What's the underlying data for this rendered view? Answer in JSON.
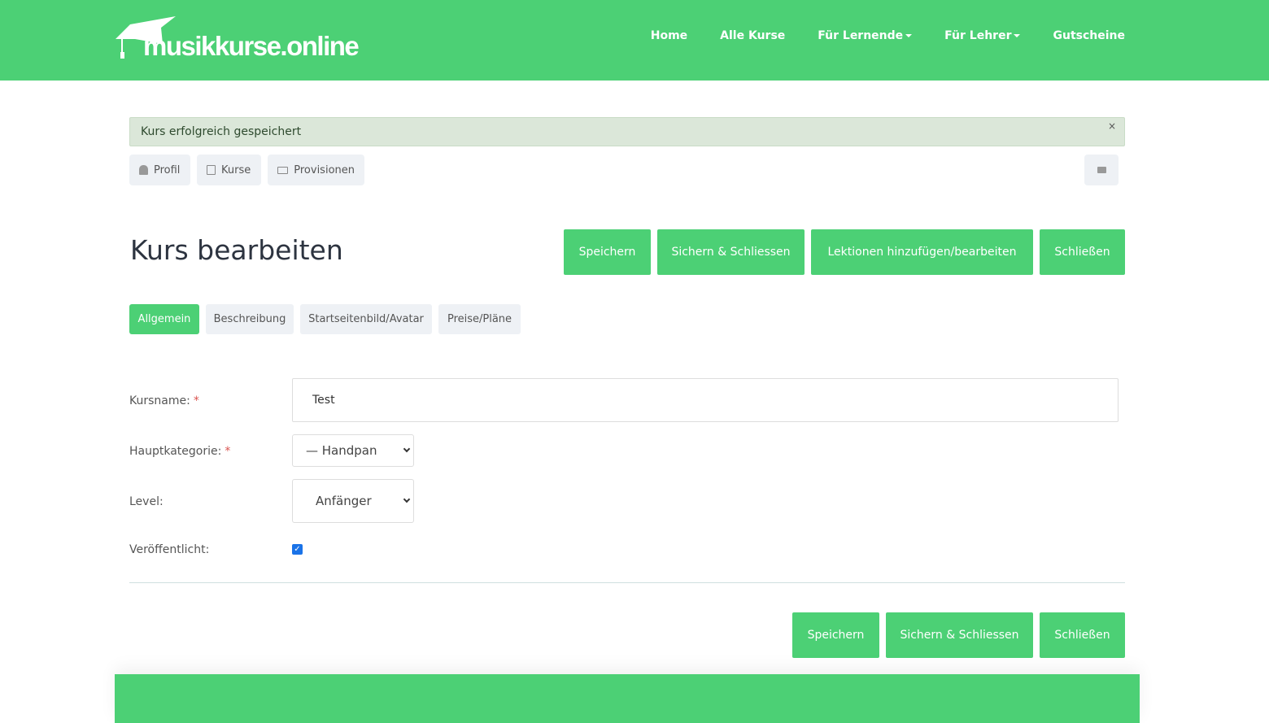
{
  "header": {
    "logo": "musikkurse.online",
    "nav": [
      "Home",
      "Alle Kurse",
      "Für Lernende",
      "Für Lehrer",
      "Gutscheine"
    ]
  },
  "alert": {
    "message": "Kurs erfolgreich gespeichert",
    "close": "×"
  },
  "profile_nav": {
    "profil": "Profil",
    "kurse": "Kurse",
    "provisionen": "Provisionen"
  },
  "page": {
    "title": "Kurs bearbeiten"
  },
  "actions": {
    "save": "Speichern",
    "save_close": "Sichern & Schliessen",
    "lessons": "Lektionen hinzufügen/bearbeiten",
    "close": "Schließen"
  },
  "tabs": [
    "Allgemein",
    "Beschreibung",
    "Startseitenbild/Avatar",
    "Preise/Pläne"
  ],
  "form": {
    "name_label": "Kursname:",
    "name_value": "Test",
    "category_label": "Hauptkategorie:",
    "category_value": "— Handpan",
    "level_label": "Level:",
    "level_value": "Anfänger",
    "published_label": "Veröffentlicht:",
    "published": true,
    "required_mark": "*"
  }
}
